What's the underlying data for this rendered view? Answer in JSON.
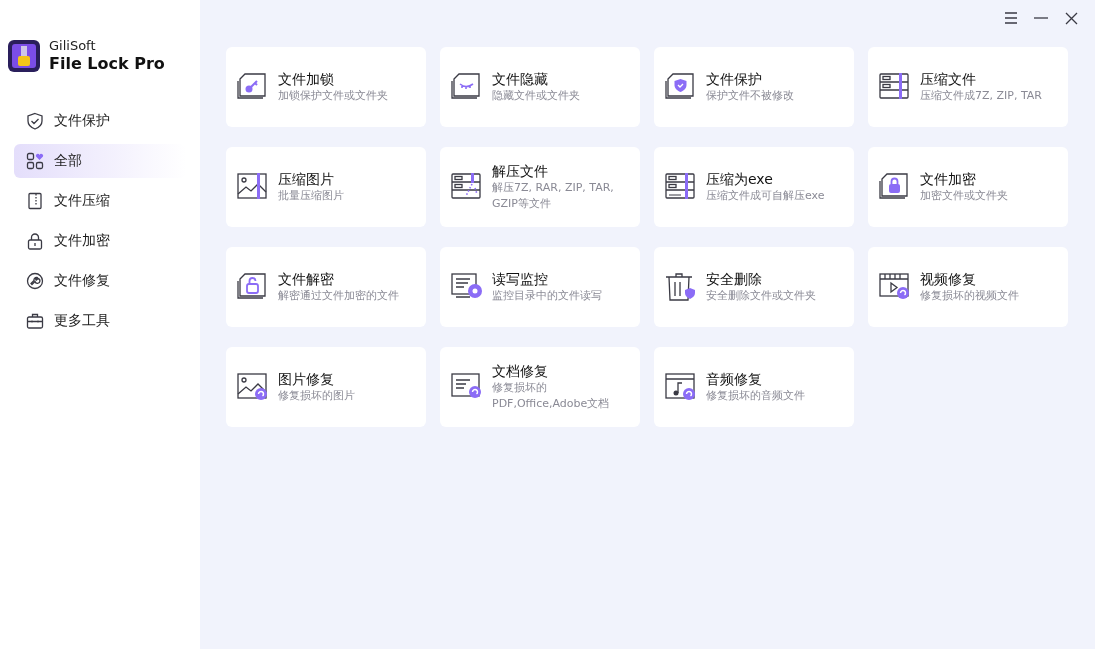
{
  "app": {
    "brand": "GiliSoft",
    "name": "File Lock Pro"
  },
  "sidebar": {
    "items": [
      {
        "label": "文件保护",
        "kind": "shield",
        "selected": false
      },
      {
        "label": "全部",
        "kind": "grid",
        "selected": true
      },
      {
        "label": "文件压缩",
        "kind": "zip",
        "selected": false
      },
      {
        "label": "文件加密",
        "kind": "lock",
        "selected": false
      },
      {
        "label": "文件修复",
        "kind": "wrench",
        "selected": false
      },
      {
        "label": "更多工具",
        "kind": "toolbox",
        "selected": false
      }
    ]
  },
  "tools": [
    {
      "title": "文件加锁",
      "desc": "加锁保护文件或文件夹",
      "kind": "key"
    },
    {
      "title": "文件隐藏",
      "desc": "隐藏文件或文件夹",
      "kind": "hide"
    },
    {
      "title": "文件保护",
      "desc": "保护文件不被修改",
      "kind": "shield"
    },
    {
      "title": "压缩文件",
      "desc": "压缩文件成7Z, ZIP, TAR",
      "kind": "zip"
    },
    {
      "title": "压缩图片",
      "desc": "批量压缩图片",
      "kind": "image"
    },
    {
      "title": "解压文件",
      "desc": "解压7Z, RAR, ZIP, TAR, GZIP等文件",
      "kind": "unzip"
    },
    {
      "title": "压缩为exe",
      "desc": "压缩文件成可自解压exe",
      "kind": "exe"
    },
    {
      "title": "文件加密",
      "desc": "加密文件或文件夹",
      "kind": "lock"
    },
    {
      "title": "文件解密",
      "desc": "解密通过文件加密的文件",
      "kind": "unlock"
    },
    {
      "title": "读写监控",
      "desc": "监控目录中的文件读写",
      "kind": "monitor"
    },
    {
      "title": "安全删除",
      "desc": "安全删除文件或文件夹",
      "kind": "trash"
    },
    {
      "title": "视频修复",
      "desc": "修复损坏的视频文件",
      "kind": "video"
    },
    {
      "title": "图片修复",
      "desc": "修复损坏的图片",
      "kind": "imagefix"
    },
    {
      "title": "文档修复",
      "desc": "修复损坏的PDF,Office,Adobe文档",
      "kind": "docfix"
    },
    {
      "title": "音频修复",
      "desc": "修复损坏的音频文件",
      "kind": "audio"
    }
  ]
}
